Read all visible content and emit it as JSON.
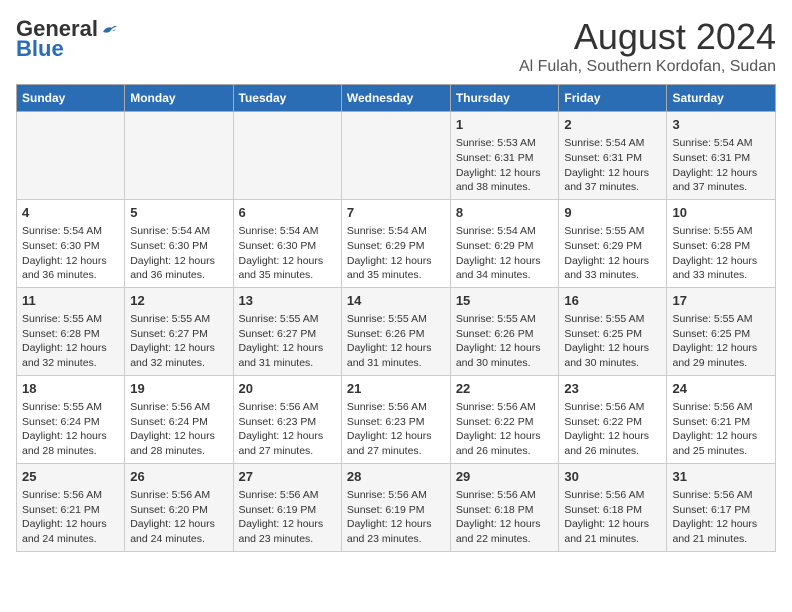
{
  "logo": {
    "general": "General",
    "blue": "Blue"
  },
  "title": "August 2024",
  "subtitle": "Al Fulah, Southern Kordofan, Sudan",
  "days_header": [
    "Sunday",
    "Monday",
    "Tuesday",
    "Wednesday",
    "Thursday",
    "Friday",
    "Saturday"
  ],
  "weeks": [
    [
      {
        "day": "",
        "content": ""
      },
      {
        "day": "",
        "content": ""
      },
      {
        "day": "",
        "content": ""
      },
      {
        "day": "",
        "content": ""
      },
      {
        "day": "1",
        "content": "Sunrise: 5:53 AM\nSunset: 6:31 PM\nDaylight: 12 hours\nand 38 minutes."
      },
      {
        "day": "2",
        "content": "Sunrise: 5:54 AM\nSunset: 6:31 PM\nDaylight: 12 hours\nand 37 minutes."
      },
      {
        "day": "3",
        "content": "Sunrise: 5:54 AM\nSunset: 6:31 PM\nDaylight: 12 hours\nand 37 minutes."
      }
    ],
    [
      {
        "day": "4",
        "content": "Sunrise: 5:54 AM\nSunset: 6:30 PM\nDaylight: 12 hours\nand 36 minutes."
      },
      {
        "day": "5",
        "content": "Sunrise: 5:54 AM\nSunset: 6:30 PM\nDaylight: 12 hours\nand 36 minutes."
      },
      {
        "day": "6",
        "content": "Sunrise: 5:54 AM\nSunset: 6:30 PM\nDaylight: 12 hours\nand 35 minutes."
      },
      {
        "day": "7",
        "content": "Sunrise: 5:54 AM\nSunset: 6:29 PM\nDaylight: 12 hours\nand 35 minutes."
      },
      {
        "day": "8",
        "content": "Sunrise: 5:54 AM\nSunset: 6:29 PM\nDaylight: 12 hours\nand 34 minutes."
      },
      {
        "day": "9",
        "content": "Sunrise: 5:55 AM\nSunset: 6:29 PM\nDaylight: 12 hours\nand 33 minutes."
      },
      {
        "day": "10",
        "content": "Sunrise: 5:55 AM\nSunset: 6:28 PM\nDaylight: 12 hours\nand 33 minutes."
      }
    ],
    [
      {
        "day": "11",
        "content": "Sunrise: 5:55 AM\nSunset: 6:28 PM\nDaylight: 12 hours\nand 32 minutes."
      },
      {
        "day": "12",
        "content": "Sunrise: 5:55 AM\nSunset: 6:27 PM\nDaylight: 12 hours\nand 32 minutes."
      },
      {
        "day": "13",
        "content": "Sunrise: 5:55 AM\nSunset: 6:27 PM\nDaylight: 12 hours\nand 31 minutes."
      },
      {
        "day": "14",
        "content": "Sunrise: 5:55 AM\nSunset: 6:26 PM\nDaylight: 12 hours\nand 31 minutes."
      },
      {
        "day": "15",
        "content": "Sunrise: 5:55 AM\nSunset: 6:26 PM\nDaylight: 12 hours\nand 30 minutes."
      },
      {
        "day": "16",
        "content": "Sunrise: 5:55 AM\nSunset: 6:25 PM\nDaylight: 12 hours\nand 30 minutes."
      },
      {
        "day": "17",
        "content": "Sunrise: 5:55 AM\nSunset: 6:25 PM\nDaylight: 12 hours\nand 29 minutes."
      }
    ],
    [
      {
        "day": "18",
        "content": "Sunrise: 5:55 AM\nSunset: 6:24 PM\nDaylight: 12 hours\nand 28 minutes."
      },
      {
        "day": "19",
        "content": "Sunrise: 5:56 AM\nSunset: 6:24 PM\nDaylight: 12 hours\nand 28 minutes."
      },
      {
        "day": "20",
        "content": "Sunrise: 5:56 AM\nSunset: 6:23 PM\nDaylight: 12 hours\nand 27 minutes."
      },
      {
        "day": "21",
        "content": "Sunrise: 5:56 AM\nSunset: 6:23 PM\nDaylight: 12 hours\nand 27 minutes."
      },
      {
        "day": "22",
        "content": "Sunrise: 5:56 AM\nSunset: 6:22 PM\nDaylight: 12 hours\nand 26 minutes."
      },
      {
        "day": "23",
        "content": "Sunrise: 5:56 AM\nSunset: 6:22 PM\nDaylight: 12 hours\nand 26 minutes."
      },
      {
        "day": "24",
        "content": "Sunrise: 5:56 AM\nSunset: 6:21 PM\nDaylight: 12 hours\nand 25 minutes."
      }
    ],
    [
      {
        "day": "25",
        "content": "Sunrise: 5:56 AM\nSunset: 6:21 PM\nDaylight: 12 hours\nand 24 minutes."
      },
      {
        "day": "26",
        "content": "Sunrise: 5:56 AM\nSunset: 6:20 PM\nDaylight: 12 hours\nand 24 minutes."
      },
      {
        "day": "27",
        "content": "Sunrise: 5:56 AM\nSunset: 6:19 PM\nDaylight: 12 hours\nand 23 minutes."
      },
      {
        "day": "28",
        "content": "Sunrise: 5:56 AM\nSunset: 6:19 PM\nDaylight: 12 hours\nand 23 minutes."
      },
      {
        "day": "29",
        "content": "Sunrise: 5:56 AM\nSunset: 6:18 PM\nDaylight: 12 hours\nand 22 minutes."
      },
      {
        "day": "30",
        "content": "Sunrise: 5:56 AM\nSunset: 6:18 PM\nDaylight: 12 hours\nand 21 minutes."
      },
      {
        "day": "31",
        "content": "Sunrise: 5:56 AM\nSunset: 6:17 PM\nDaylight: 12 hours\nand 21 minutes."
      }
    ]
  ]
}
